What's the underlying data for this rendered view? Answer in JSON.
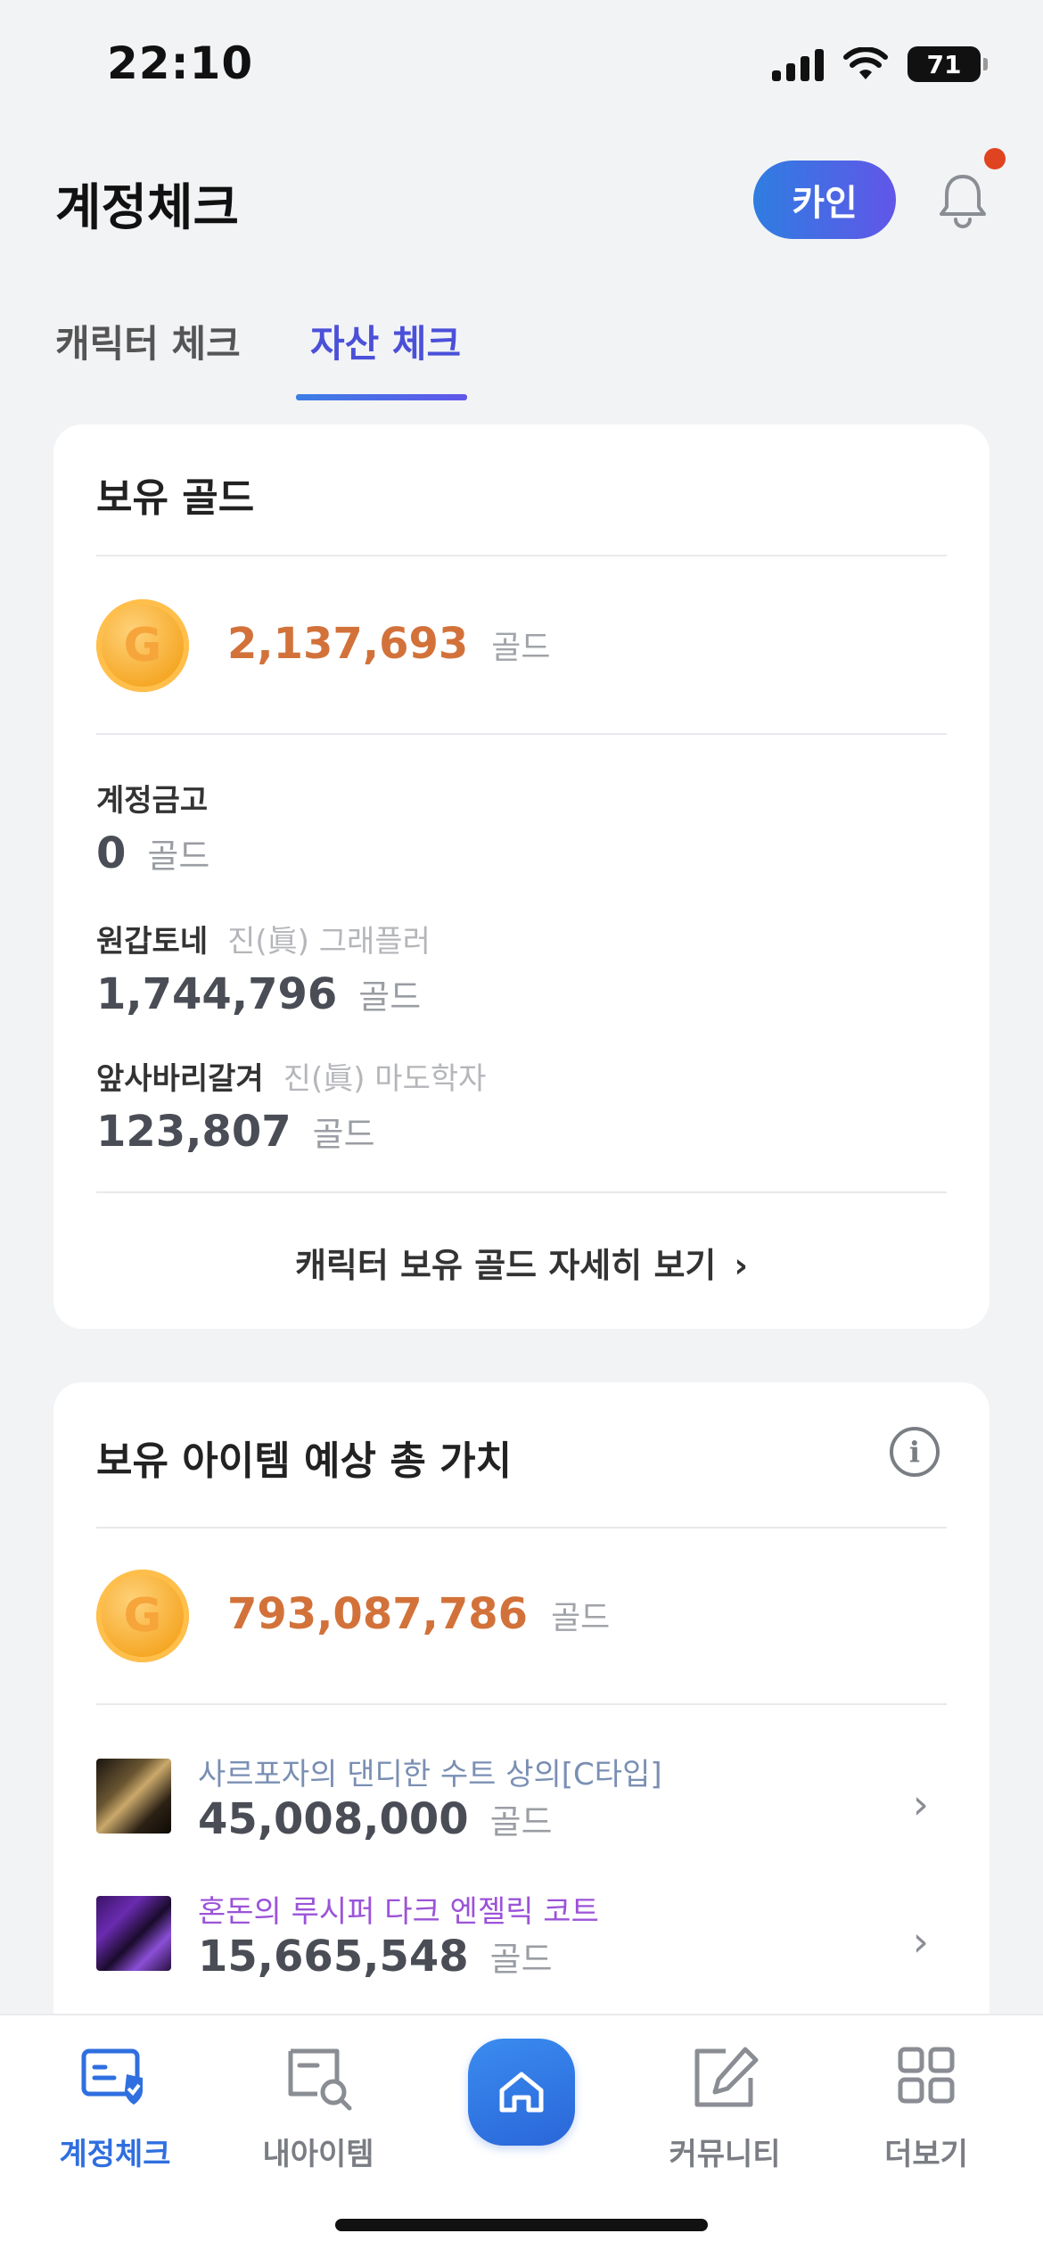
{
  "status_bar": {
    "time": "22:10",
    "battery": "71"
  },
  "header": {
    "title": "계정체크",
    "user_name": "카인"
  },
  "tabs": [
    {
      "label": "캐릭터 체크",
      "active": false
    },
    {
      "label": "자산 체크",
      "active": true
    }
  ],
  "gold_card": {
    "title": "보유 골드",
    "coin_letter": "G",
    "total": "2,137,693",
    "unit": "골드",
    "entries": [
      {
        "label": "계정금고",
        "class": "",
        "value": "0",
        "unit": "골드"
      },
      {
        "label": "원갑토네",
        "class": "진(眞) 그래플러",
        "value": "1,744,796",
        "unit": "골드"
      },
      {
        "label": "앞사바리갈겨",
        "class": "진(眞) 마도학자",
        "value": "123,807",
        "unit": "골드"
      }
    ],
    "detail_link": "캐릭터 보유 골드 자세히 보기"
  },
  "items_card": {
    "title": "보유 아이템 예상 총 가치",
    "coin_letter": "G",
    "total": "793,087,786",
    "unit": "골드",
    "items": [
      {
        "name": "사르포자의 댄디한 수트 상의[C타입]",
        "value": "45,008,000",
        "unit": "골드",
        "name_color": "#7a8fb3"
      },
      {
        "name": "혼돈의 루시퍼 다크 엔젤릭 코트",
        "value": "15,665,548",
        "unit": "골드",
        "name_color": "#9b53d8"
      }
    ]
  },
  "bottom_nav": [
    {
      "label": "계정체크",
      "icon": "account-check-icon",
      "active": true
    },
    {
      "label": "내아이템",
      "icon": "my-items-icon",
      "active": false
    },
    {
      "label": "",
      "icon": "home-icon",
      "active": false
    },
    {
      "label": "커뮤니티",
      "icon": "edit-icon",
      "active": false
    },
    {
      "label": "더보기",
      "icon": "grid-icon",
      "active": false
    }
  ],
  "colors": {
    "accent": "#4b50d9",
    "gold_value": "#d2723a",
    "notification": "#e0431f"
  }
}
